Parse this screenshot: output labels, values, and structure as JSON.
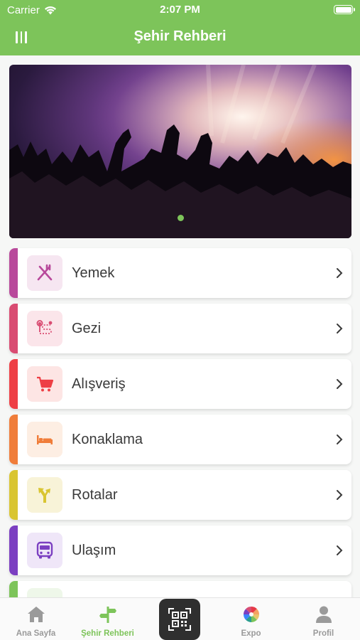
{
  "status_bar": {
    "carrier": "Carrier",
    "time": "2:07 PM"
  },
  "header": {
    "title": "Şehir Rehberi"
  },
  "banner": {
    "image": "concert crowd photo",
    "page_indicator": {
      "count": 1,
      "active": 1
    }
  },
  "categories": [
    {
      "label": "Yemek",
      "icon": "utensils-icon",
      "accent": "#b8499b",
      "icon_color": "#b8499b",
      "icon_bg": "#f6e6f1"
    },
    {
      "label": "Gezi",
      "icon": "map-route-icon",
      "accent": "#d94c72",
      "icon_color": "#d94c72",
      "icon_bg": "#fbe5ea"
    },
    {
      "label": "Alışveriş",
      "icon": "cart-icon",
      "accent": "#ee3f45",
      "icon_color": "#ee3f45",
      "icon_bg": "#fde5e4"
    },
    {
      "label": "Konaklama",
      "icon": "bed-icon",
      "accent": "#f07d3a",
      "icon_color": "#f07d3a",
      "icon_bg": "#fdeee3"
    },
    {
      "label": "Rotalar",
      "icon": "signpost-icon",
      "accent": "#d9c531",
      "icon_color": "#d9c531",
      "icon_bg": "#f8f3d8"
    },
    {
      "label": "Ulaşım",
      "icon": "bus-icon",
      "accent": "#7b3fc1",
      "icon_color": "#7b3fc1",
      "icon_bg": "#efe6f8"
    },
    {
      "label": "",
      "icon": "",
      "accent": "#7dc45a",
      "icon_color": "#7dc45a",
      "icon_bg": "#eef7e9"
    }
  ],
  "tabs": [
    {
      "label": "Ana Sayfa",
      "icon": "home-icon",
      "active": false
    },
    {
      "label": "Şehir Rehberi",
      "icon": "city-guide-icon",
      "active": true
    },
    {
      "label": "",
      "icon": "qr-scan-icon",
      "active": false
    },
    {
      "label": "Expo",
      "icon": "expo-icon",
      "active": false
    },
    {
      "label": "Profil",
      "icon": "profile-icon",
      "active": false
    }
  ],
  "colors": {
    "brand_green": "#7dc45a",
    "tab_inactive": "#9a9a9a",
    "scan_button": "#2f2f2f"
  }
}
